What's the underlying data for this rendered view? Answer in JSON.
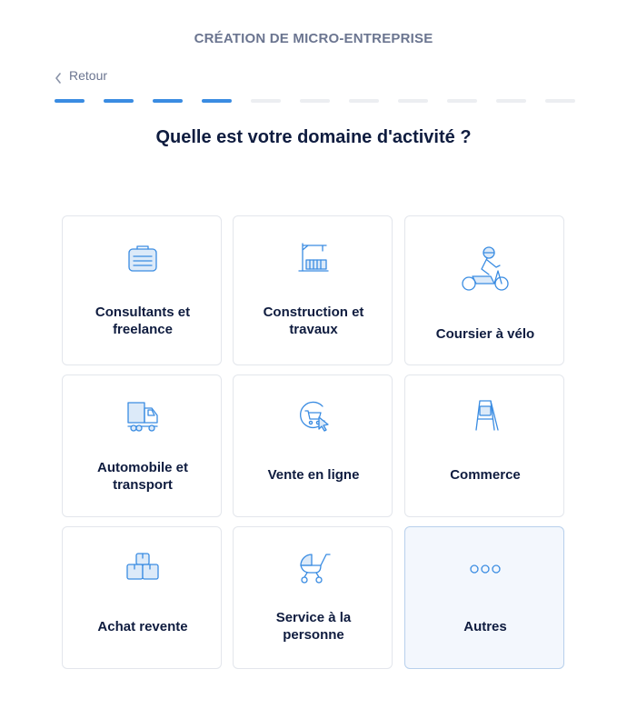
{
  "header": {
    "title": "CRÉATION DE MICRO-ENTREPRISE"
  },
  "nav": {
    "back_label": "Retour"
  },
  "progress": {
    "total_steps": 11,
    "completed_steps": 4
  },
  "question": "Quelle est votre domaine d'activité ?",
  "options": [
    {
      "label": "Consultants et\nfreelance",
      "icon": "briefcase-icon",
      "selected": false
    },
    {
      "label": "Construction et\ntravaux",
      "icon": "crane-icon",
      "selected": false
    },
    {
      "label": "Coursier à vélo",
      "icon": "scooter-rider-icon",
      "selected": false
    },
    {
      "label": "Automobile et\ntransport",
      "icon": "truck-icon",
      "selected": false
    },
    {
      "label": "Vente en ligne",
      "icon": "online-cart-icon",
      "selected": false
    },
    {
      "label": "Commerce",
      "icon": "sign-board-icon",
      "selected": false
    },
    {
      "label": "Achat revente",
      "icon": "boxes-icon",
      "selected": false
    },
    {
      "label": "Service à la\npersonne",
      "icon": "stroller-icon",
      "selected": false
    },
    {
      "label": "Autres",
      "icon": "more-dots-icon",
      "selected": true
    }
  ],
  "colors": {
    "accent": "#3a8ce2",
    "progress_inactive": "#eceef1",
    "text_primary": "#0f1c3f",
    "text_muted": "#6b7590",
    "card_border": "#e3e6ec",
    "selected_bg": "#f3f7fd"
  }
}
